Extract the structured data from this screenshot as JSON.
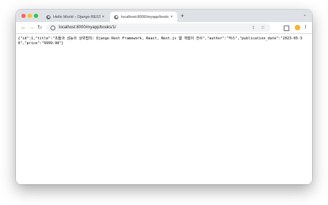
{
  "tabs": [
    {
      "title": "Hello World – Django REST fra",
      "close": "×"
    },
    {
      "title": "localhost:8000/myapp/books/1/",
      "close": "×"
    }
  ],
  "newtab": "+",
  "tab_search": "⌄",
  "nav": {
    "back": "←",
    "forward": "→",
    "reload": "↻"
  },
  "address": {
    "url": "localhost:8000/myapp/books/1/",
    "share": "⇪",
    "star": "☆"
  },
  "menu": "⋮",
  "body_text": "{\"id\":1,\"title\":\"초들과 성능의 상위법칙: Django Rest Framework, React, Next.js 웹 개발의 전수\",\"author\":\"작스\",\"publication_date\":\"2023-05-30\",\"price\":\"9999.98\"}",
  "colors": {
    "tabstrip": "#dee1e6",
    "red": "#ff5f57",
    "yellow": "#febc2e",
    "green": "#28c840"
  }
}
